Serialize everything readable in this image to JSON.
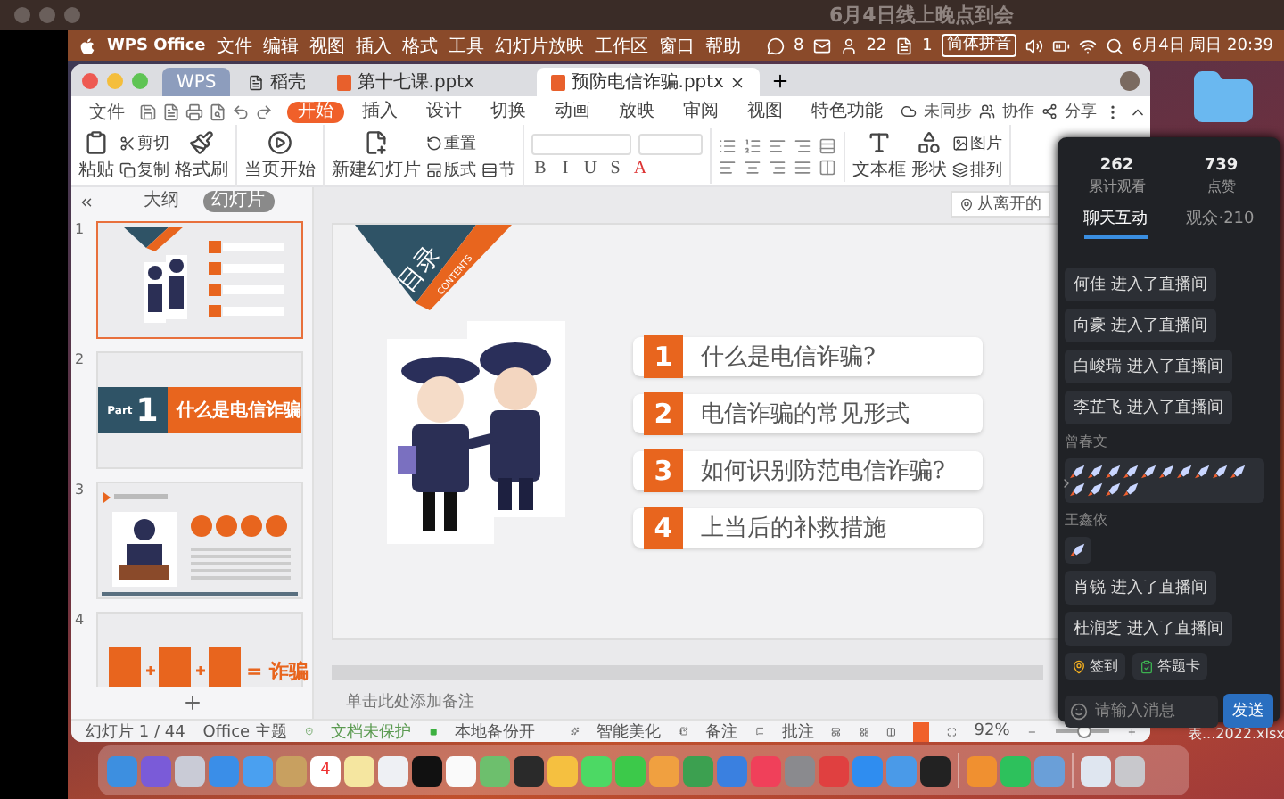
{
  "screen_title": "6月4日线上晚点到会",
  "menu_bar": {
    "app": "WPS Office",
    "items": [
      "文件",
      "编辑",
      "视图",
      "插入",
      "格式",
      "工具",
      "幻灯片放映",
      "工作区",
      "窗口",
      "帮助"
    ],
    "status": [
      {
        "kind": "chat",
        "text": "8"
      },
      {
        "kind": "mail"
      },
      {
        "kind": "person",
        "text": "22"
      },
      {
        "kind": "doc",
        "text": "1"
      },
      {
        "kind": "input",
        "text": "简体拼音"
      },
      {
        "kind": "volume"
      },
      {
        "kind": "battery"
      },
      {
        "kind": "wifi"
      },
      {
        "kind": "search"
      }
    ],
    "clock": "6月4日 周日 20:39"
  },
  "wps": {
    "tabs": [
      {
        "kind": "home",
        "label": "WPS",
        "selected": false
      },
      {
        "kind": "docer",
        "label": "稻壳",
        "selected": false
      },
      {
        "kind": "doc",
        "label": "第十七课.pptx",
        "selected": false
      },
      {
        "kind": "doc",
        "label": "预防电信诈骗.pptx",
        "selected": true
      }
    ],
    "file_menu": "文件",
    "menu": [
      {
        "label": "开始",
        "selected": true
      },
      {
        "label": "插入",
        "selected": false
      },
      {
        "label": "设计",
        "selected": false
      },
      {
        "label": "切换",
        "selected": false
      },
      {
        "label": "动画",
        "selected": false
      },
      {
        "label": "放映",
        "selected": false
      },
      {
        "label": "审阅",
        "selected": false
      },
      {
        "label": "视图",
        "selected": false
      },
      {
        "label": "特色功能",
        "selected": false
      }
    ],
    "actions": [
      {
        "kind": "sync",
        "label": "未同步"
      },
      {
        "kind": "collab",
        "label": "协作"
      },
      {
        "kind": "share",
        "label": "分享"
      }
    ],
    "ribbon_left": [
      [
        [
          {
            "kind": "paste",
            "label": "粘贴"
          }
        ],
        [
          {
            "kind": "cut",
            "label": "剪切"
          },
          {
            "kind": "copy",
            "label": "复制"
          }
        ],
        [
          {
            "kind": "painter",
            "label": "格式刷"
          }
        ]
      ],
      [
        [
          {
            "kind": "play",
            "label": "当页开始"
          }
        ]
      ],
      [
        [
          {
            "kind": "new_slide",
            "label": "新建幻灯片"
          }
        ],
        [
          {
            "kind": "reset",
            "label": "重置"
          },
          {
            "kind": "layout",
            "label": "版式"
          }
        ],
        [
          {
            "kind": "section",
            "label": "节"
          }
        ]
      ]
    ],
    "format_letters": [
      "B",
      "I",
      "U",
      "S",
      "A"
    ],
    "ribbon_right": [
      [
        [
          {
            "kind": "textbox",
            "label": "文本框"
          }
        ],
        [
          {
            "kind": "shape",
            "label": "形状"
          }
        ],
        [
          {
            "kind": "picture",
            "label": "图片"
          },
          {
            "kind": "arrange",
            "label": "排列"
          }
        ]
      ]
    ],
    "panel_tabs": [
      {
        "label": "大纲",
        "selected": false
      },
      {
        "label": "幻灯片",
        "selected": true
      }
    ],
    "thumbnails": [
      {
        "number": "1",
        "kind": "contents",
        "selected": true
      },
      {
        "number": "2",
        "kind": "part",
        "part_label": "Part",
        "part_number": "1",
        "title": "什么是电信诈骗",
        "selected": false
      },
      {
        "number": "3",
        "kind": "intro",
        "selected": false
      },
      {
        "number": "4",
        "kind": "formula",
        "result": "= 诈骗",
        "selected": false
      }
    ],
    "resume_tag": "从离开的",
    "slide": {
      "badge_title": "目录",
      "badge_subtitle": "CONTENTS",
      "items": [
        {
          "number": "1",
          "text": "什么是电信诈骗?"
        },
        {
          "number": "2",
          "text": "电信诈骗的常见形式"
        },
        {
          "number": "3",
          "text": "如何识别防范电信诈骗?"
        },
        {
          "number": "4",
          "text": "上当后的补救措施"
        }
      ]
    },
    "notes_placeholder": "单击此处添加备注",
    "status": {
      "slide_count": "幻灯片 1 / 44",
      "theme": "Office 主题",
      "protection": "文档未保护",
      "backup": "本地备份开",
      "beautify": "智能美化",
      "notes": "备注",
      "comments": "批注",
      "zoom": "92%",
      "zoom_slider": {
        "level": 0.55
      }
    }
  },
  "chat": {
    "stats": [
      {
        "value": "262",
        "label": "累计观看"
      },
      {
        "value": "739",
        "label": "点赞"
      }
    ],
    "tabs": [
      {
        "label": "聊天互动",
        "selected": true
      },
      {
        "label": "观众·210",
        "selected": false
      }
    ],
    "messages": [
      {
        "kind": "join",
        "text": "何佳 进入了直播间"
      },
      {
        "kind": "join",
        "text": "向豪 进入了直播间"
      },
      {
        "kind": "join",
        "text": "白峻瑞 进入了直播间"
      },
      {
        "kind": "join",
        "text": "李芷飞 进入了直播间"
      },
      {
        "kind": "burst",
        "name": "曾春文"
      },
      {
        "kind": "gift",
        "name": "王鑫依"
      },
      {
        "kind": "join",
        "text": "肖锐 进入了直播间"
      },
      {
        "kind": "join",
        "text": "杜润芝 进入了直播间"
      }
    ],
    "buttons": [
      {
        "kind": "checkin",
        "label": "签到"
      },
      {
        "kind": "quiz",
        "label": "答题卡"
      }
    ],
    "placeholder": "请输入消息",
    "send": "发送"
  },
  "desktop_file": "表...2022.xlsx",
  "dock": [
    {
      "kind": "app",
      "color": "#3d8fe0"
    },
    {
      "kind": "app",
      "color": "#7a5bd8"
    },
    {
      "kind": "app",
      "color": "#c9cbd6"
    },
    {
      "kind": "app",
      "color": "#3a8ee8"
    },
    {
      "kind": "app",
      "color": "#4aa0f0"
    },
    {
      "kind": "app",
      "color": "#c8a060"
    },
    {
      "kind": "calendar",
      "color": "#ffffff",
      "text": "4"
    },
    {
      "kind": "app",
      "color": "#f5e6a0"
    },
    {
      "kind": "app",
      "color": "#eef0f4"
    },
    {
      "kind": "app",
      "color": "#111111"
    },
    {
      "kind": "app",
      "color": "#fafafa"
    },
    {
      "kind": "app",
      "color": "#6dbf6d"
    },
    {
      "kind": "app",
      "color": "#2a2a2a"
    },
    {
      "kind": "app",
      "color": "#f5c040"
    },
    {
      "kind": "app",
      "color": "#4cd964"
    },
    {
      "kind": "app",
      "color": "#3cc94a"
    },
    {
      "kind": "app",
      "color": "#f0a040"
    },
    {
      "kind": "app",
      "color": "#3ca050"
    },
    {
      "kind": "app",
      "color": "#3a80e0"
    },
    {
      "kind": "app",
      "color": "#f0405a"
    },
    {
      "kind": "app",
      "color": "#8a8a8e"
    },
    {
      "kind": "app",
      "color": "#e04040"
    },
    {
      "kind": "app",
      "color": "#2f8df0"
    },
    {
      "kind": "app",
      "color": "#4a9ae8"
    },
    {
      "kind": "app",
      "color": "#222222"
    },
    {
      "kind": "separator"
    },
    {
      "kind": "app",
      "color": "#f09030"
    },
    {
      "kind": "app",
      "color": "#2dc15c"
    },
    {
      "kind": "app",
      "color": "#6a9fd8"
    },
    {
      "kind": "separator"
    },
    {
      "kind": "app",
      "color": "#dfe6f0"
    },
    {
      "kind": "app",
      "color": "#c8c8cc"
    }
  ]
}
